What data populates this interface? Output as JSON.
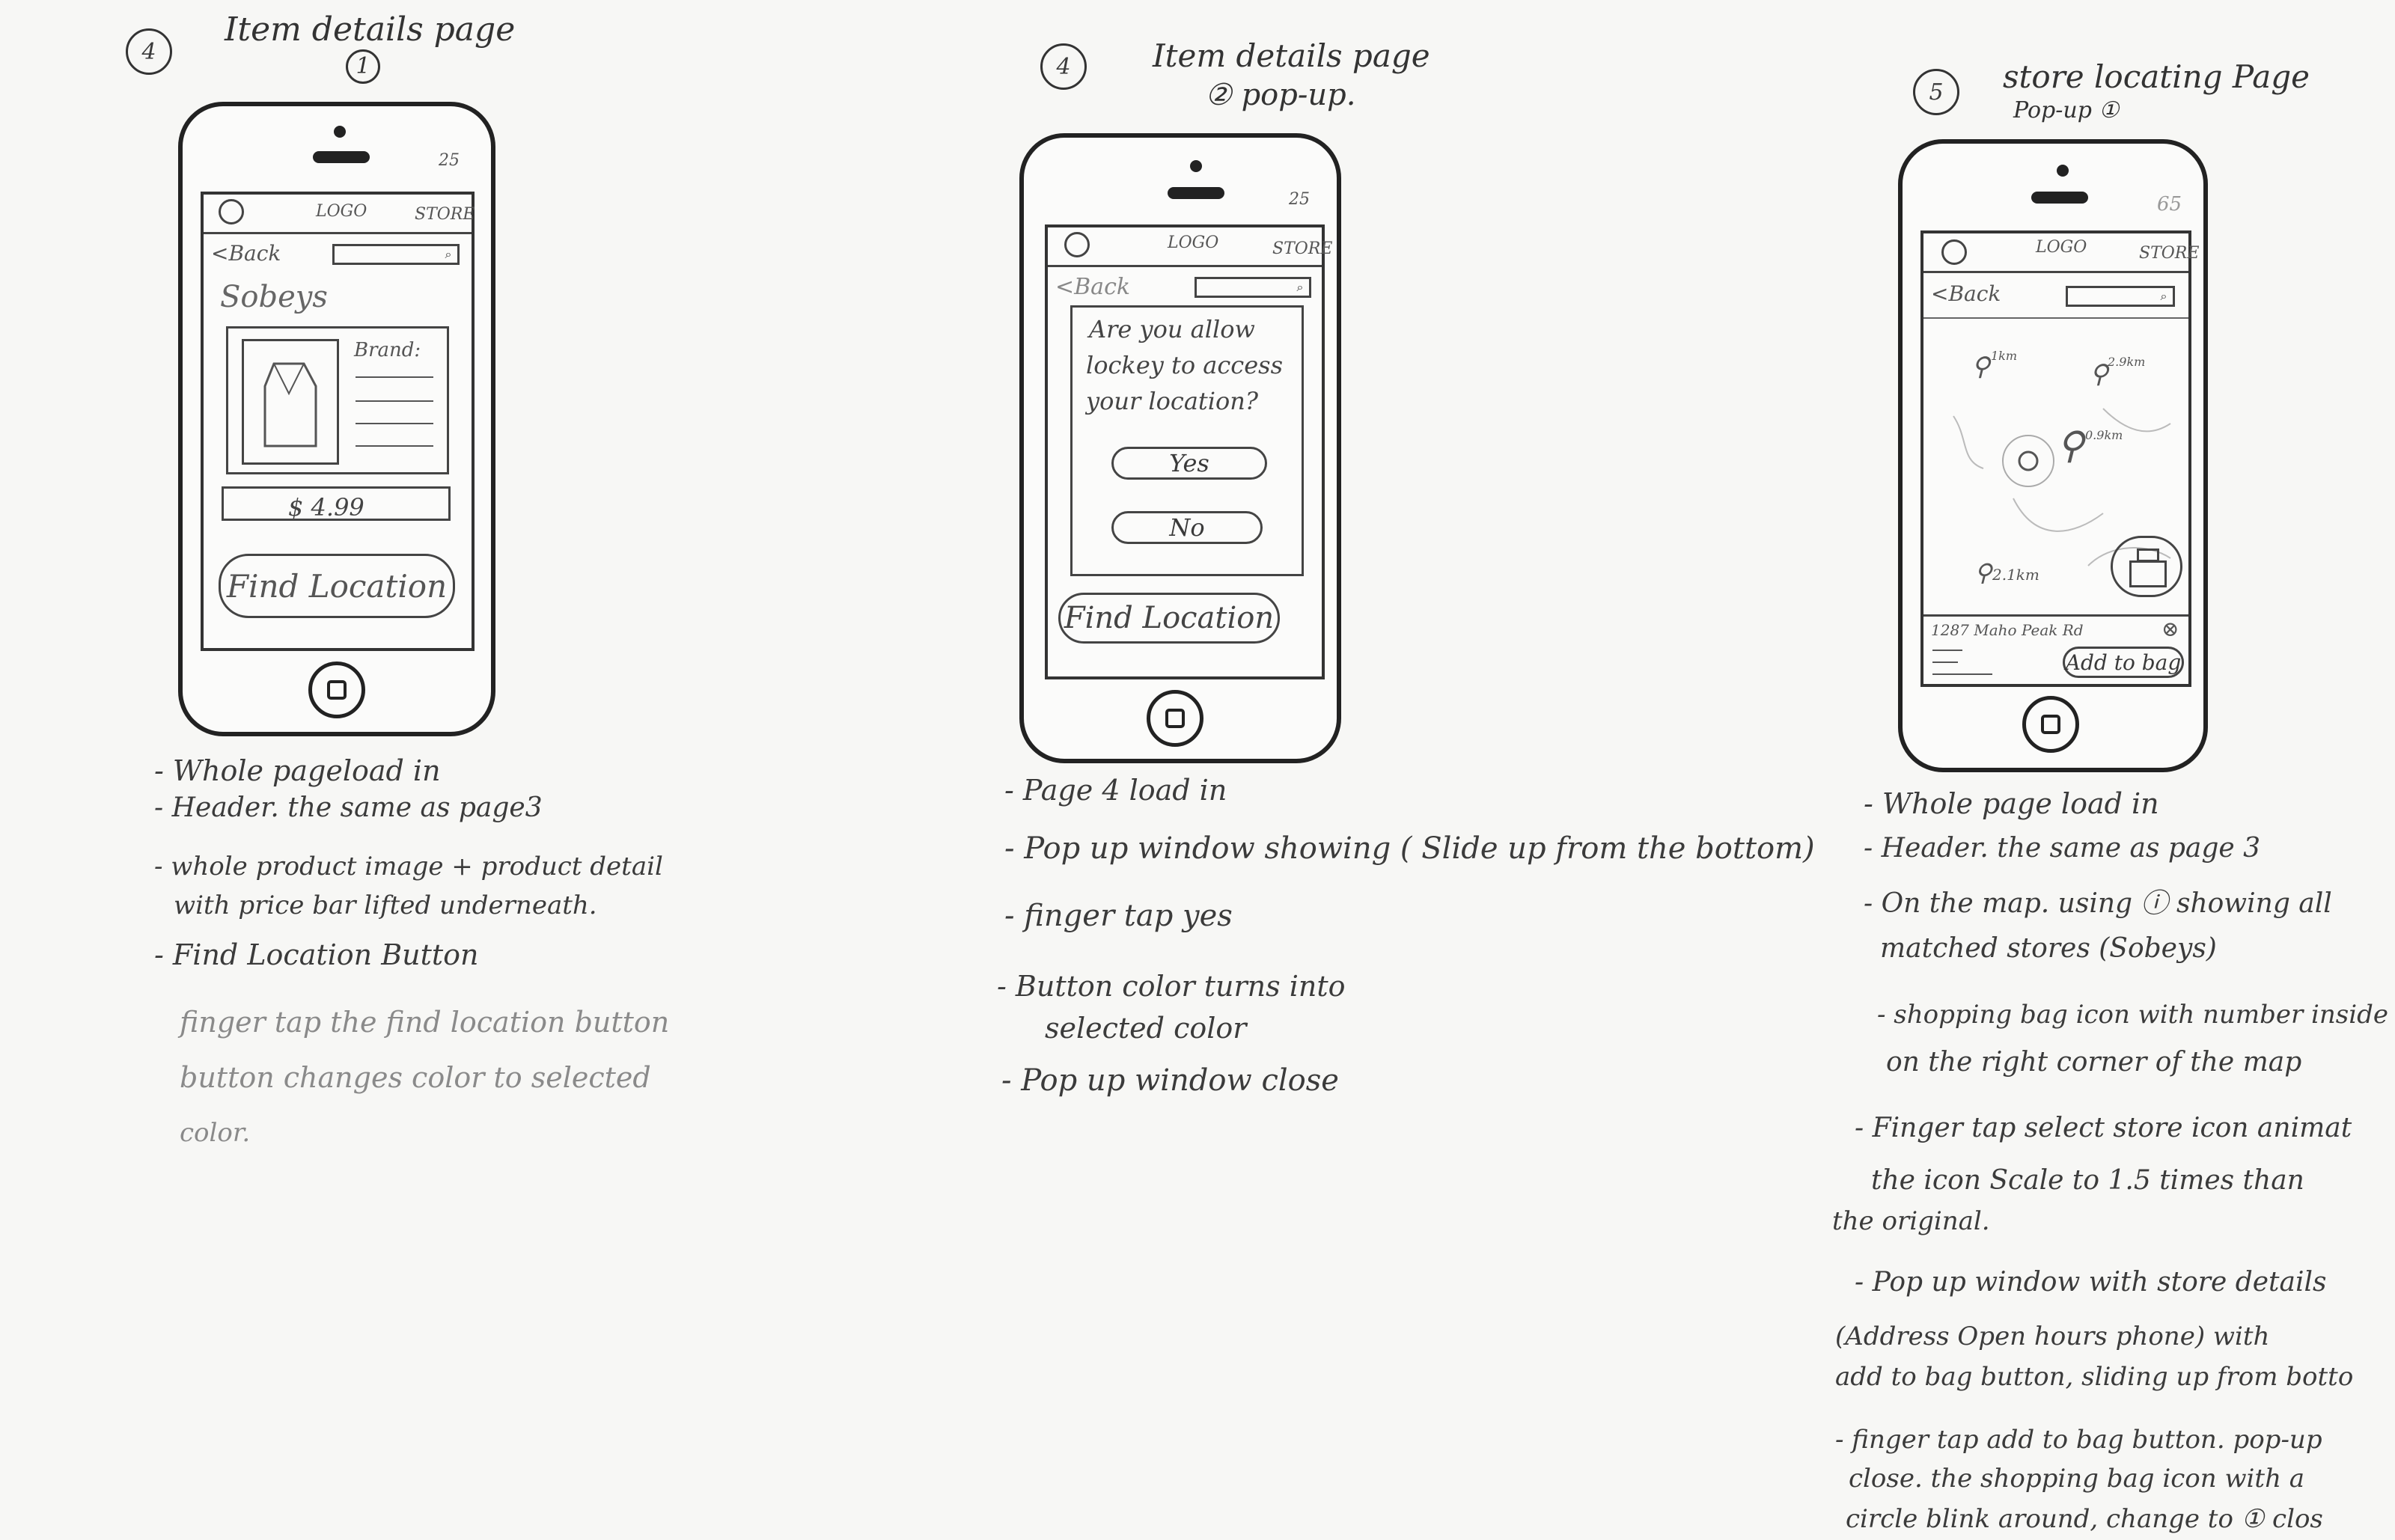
{
  "panels": [
    {
      "number": "4",
      "title": "Item details page",
      "subtitle": "1",
      "status": "25",
      "header": {
        "logo": "LOGO",
        "store": "STORE",
        "back": "<Back"
      },
      "store_name": "Sobeys",
      "brand_label": "Brand:",
      "price": "$ 4.99",
      "button": "Find Location",
      "notes": [
        "- Whole pageload in",
        "- Header. the same as page3",
        "- whole product image + product detail",
        "with price bar lifted underneath.",
        "- Find Location Button",
        "finger tap the find location button",
        "button changes color to selected",
        "color."
      ]
    },
    {
      "number": "4",
      "title": "Item details page",
      "subtitle": "② pop-up.",
      "status": "25",
      "header": {
        "logo": "LOGO",
        "store": "STORE",
        "back": "<Back"
      },
      "popup_text": [
        "Are you allow",
        "lockey to access",
        "your location?"
      ],
      "yes": "Yes",
      "no": "No",
      "button": "Find Location",
      "notes": [
        "- Page 4 load in",
        "- Pop up window showing ( Slide up from the bottom)",
        "- finger tap yes",
        "- Button color turns into",
        "selected color",
        "- Pop up window close"
      ]
    },
    {
      "number": "5",
      "title": "store locating Page",
      "subtitle": "Pop-up ①",
      "status": "65",
      "header": {
        "logo": "LOGO",
        "store": "STORE",
        "back": "<Back"
      },
      "map_labels": [
        "1km",
        "2.9km",
        "0.9km",
        "2.1km"
      ],
      "address": "1287 Maho Peak Rd",
      "close": "⊗",
      "button": "Add to bag",
      "notes": [
        "- Whole page load in",
        "- Header. the same as page 3",
        "- On the map. using ⓘ showing all",
        "matched stores (Sobeys)",
        "- shopping bag icon with number inside",
        "on the right corner of the map",
        "- Finger tap select store icon animat",
        "the icon Scale to 1.5 times than",
        "the original.",
        "- Pop up window with store details",
        "(Address Open hours phone) with",
        "add to bag button, sliding up from botto",
        "- finger tap add to bag button. pop-up",
        "close. the shopping bag icon with a",
        "circle blink around, change to ① clos"
      ]
    }
  ]
}
